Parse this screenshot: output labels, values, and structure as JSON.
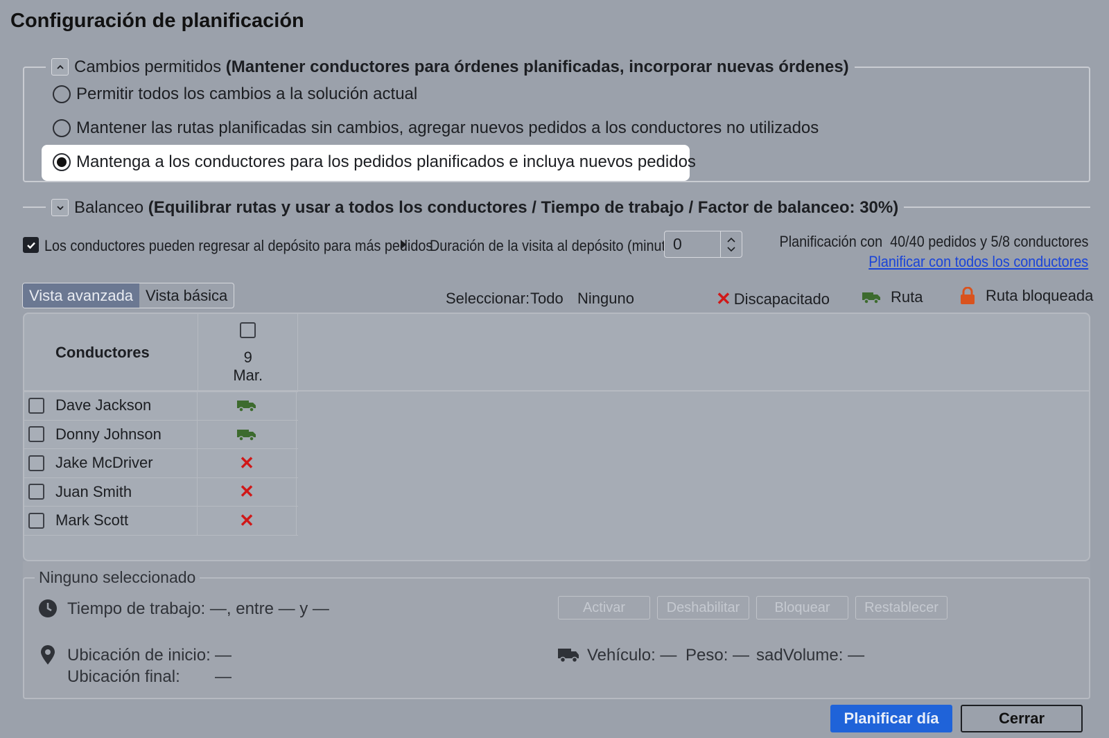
{
  "dialog": {
    "title": "Configuración de planificación"
  },
  "changes": {
    "label": "Cambios permitidos",
    "summary": "(Mantener conductores para órdenes planificadas, incorporar nuevas órdenes)",
    "options": [
      {
        "label": "Permitir todos los cambios a la solución actual",
        "selected": false
      },
      {
        "label": "Mantener las rutas planificadas sin cambios, agregar nuevos pedidos a los conductores no utilizados",
        "selected": false
      },
      {
        "label": "Mantenga a los conductores para los pedidos planificados e incluya nuevos pedidos",
        "selected": true
      }
    ]
  },
  "balance": {
    "label": "Balanceo",
    "summary": "(Equilibrar rutas y usar a todos los conductores / Tiempo de trabajo / Factor de balanceo: 30%)"
  },
  "options": {
    "return_depot_label": "Los conductores pueden regresar al depósito para más pedidos",
    "return_depot_checked": true,
    "visit_duration_label": "Duración de la visita al depósito (minutos):",
    "visit_duration_value": "0"
  },
  "plan_status": {
    "prefix": "Planificación con",
    "orders": "40/40",
    "orders_word": "pedidos y",
    "drivers": "5/8",
    "drivers_word": "conductores",
    "link": "Planificar con todos los conductores"
  },
  "view_toggle": {
    "advanced": "Vista avanzada",
    "basic": "Vista básica",
    "active": "advanced"
  },
  "select": {
    "label": "Seleccionar:",
    "all": "Todo",
    "none": "Ninguno"
  },
  "legend": {
    "disabled": "Discapacitado",
    "route": "Ruta",
    "locked": "Ruta bloqueada"
  },
  "grid": {
    "drivers_header": "Conductores",
    "date_day": "9",
    "date_month": "Mar.",
    "rows": [
      {
        "name": "Dave Jackson",
        "status": "route"
      },
      {
        "name": "Donny Johnson",
        "status": "route"
      },
      {
        "name": "Jake McDriver",
        "status": "disabled"
      },
      {
        "name": "Juan Smith",
        "status": "disabled"
      },
      {
        "name": "Mark Scott",
        "status": "disabled"
      }
    ]
  },
  "details": {
    "legend": "Ninguno seleccionado",
    "work_time": "Tiempo de trabajo: —, entre — y —",
    "start_label": "Ubicación de inicio:",
    "start_value": "—",
    "end_label": "Ubicación final:",
    "end_value": "—",
    "vehicle": "Vehículo: —",
    "weight": "Peso: —",
    "volume": "sadVolume: —",
    "buttons": [
      "Activar",
      "Deshabilitar",
      "Bloquear",
      "Restablecer"
    ]
  },
  "footer": {
    "plan_day": "Planificar día",
    "close": "Cerrar"
  },
  "colors": {
    "primary": "#1f63d9",
    "route_icon": "#3d6b2e",
    "disabled_x": "#d01818",
    "lock": "#d9531e",
    "link": "#1a44d8"
  }
}
